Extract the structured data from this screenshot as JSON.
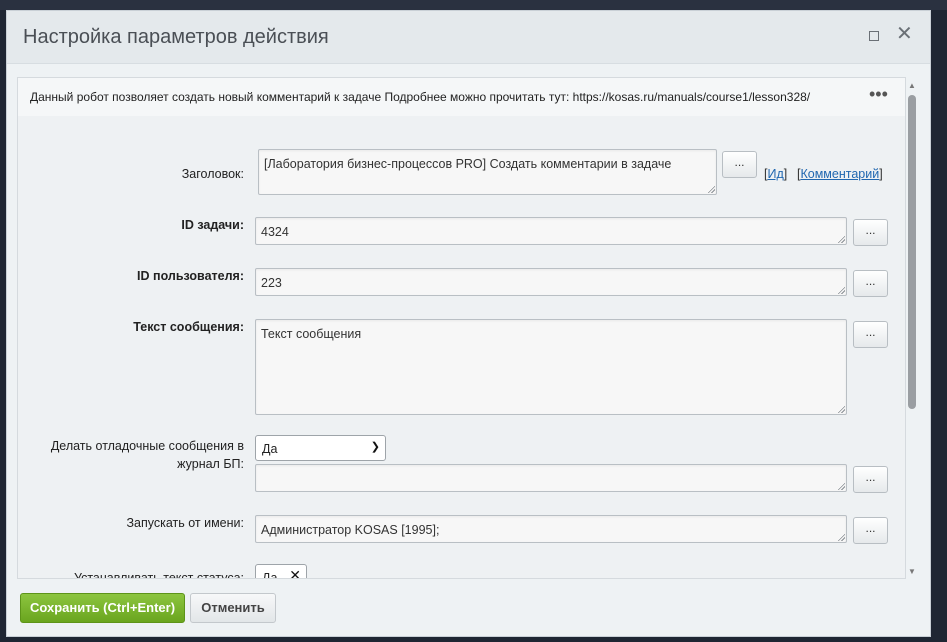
{
  "dialog": {
    "title": "Настройка параметров действия"
  },
  "info": {
    "text": "Данный робот позволяет создать новый комментарий к задаче Подробнее можно прочитать тут: https://kosas.ru/manuals/course1/lesson328/",
    "more_icon": "•••"
  },
  "form": {
    "title_label": "Заголовок:",
    "title_value": "[Лаборатория бизнес-процессов PRO] Создать комментарии в задаче",
    "link_id": "Ид",
    "link_comment": "Комментарий",
    "task_id_label": "ID задачи:",
    "task_id_value": "4324",
    "user_id_label": "ID пользователя:",
    "user_id_value": "223",
    "message_label": "Текст сообщения:",
    "message_value": "Текст сообщения",
    "debug_label": "Делать отладочные сообщения в журнал БП:",
    "debug_value": "Да",
    "run_as_label": "Запускать от имени:",
    "run_as_value": "Администратор KOSAS [1995];",
    "status_label": "Устанавливать текст статуса:",
    "status_value": "Да",
    "dots": "..."
  },
  "footer": {
    "save_label": "Сохранить (Ctrl+Enter)",
    "cancel_label": "Отменить"
  }
}
